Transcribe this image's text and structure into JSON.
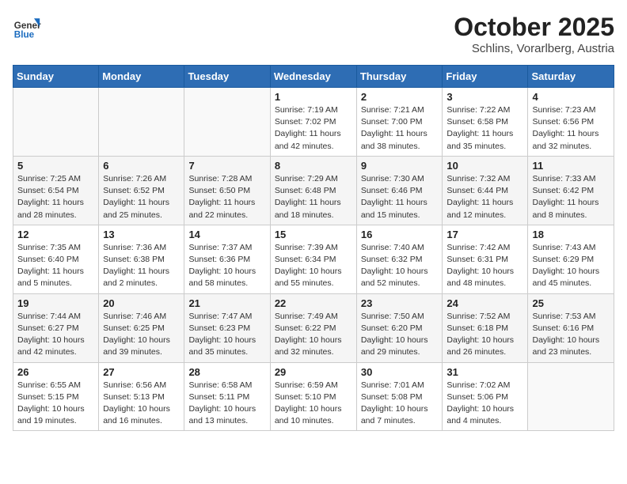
{
  "header": {
    "logo_general": "General",
    "logo_blue": "Blue",
    "month": "October 2025",
    "location": "Schlins, Vorarlberg, Austria"
  },
  "weekdays": [
    "Sunday",
    "Monday",
    "Tuesday",
    "Wednesday",
    "Thursday",
    "Friday",
    "Saturday"
  ],
  "weeks": [
    [
      {
        "day": "",
        "info": ""
      },
      {
        "day": "",
        "info": ""
      },
      {
        "day": "",
        "info": ""
      },
      {
        "day": "1",
        "info": "Sunrise: 7:19 AM\nSunset: 7:02 PM\nDaylight: 11 hours and 42 minutes."
      },
      {
        "day": "2",
        "info": "Sunrise: 7:21 AM\nSunset: 7:00 PM\nDaylight: 11 hours and 38 minutes."
      },
      {
        "day": "3",
        "info": "Sunrise: 7:22 AM\nSunset: 6:58 PM\nDaylight: 11 hours and 35 minutes."
      },
      {
        "day": "4",
        "info": "Sunrise: 7:23 AM\nSunset: 6:56 PM\nDaylight: 11 hours and 32 minutes."
      }
    ],
    [
      {
        "day": "5",
        "info": "Sunrise: 7:25 AM\nSunset: 6:54 PM\nDaylight: 11 hours and 28 minutes."
      },
      {
        "day": "6",
        "info": "Sunrise: 7:26 AM\nSunset: 6:52 PM\nDaylight: 11 hours and 25 minutes."
      },
      {
        "day": "7",
        "info": "Sunrise: 7:28 AM\nSunset: 6:50 PM\nDaylight: 11 hours and 22 minutes."
      },
      {
        "day": "8",
        "info": "Sunrise: 7:29 AM\nSunset: 6:48 PM\nDaylight: 11 hours and 18 minutes."
      },
      {
        "day": "9",
        "info": "Sunrise: 7:30 AM\nSunset: 6:46 PM\nDaylight: 11 hours and 15 minutes."
      },
      {
        "day": "10",
        "info": "Sunrise: 7:32 AM\nSunset: 6:44 PM\nDaylight: 11 hours and 12 minutes."
      },
      {
        "day": "11",
        "info": "Sunrise: 7:33 AM\nSunset: 6:42 PM\nDaylight: 11 hours and 8 minutes."
      }
    ],
    [
      {
        "day": "12",
        "info": "Sunrise: 7:35 AM\nSunset: 6:40 PM\nDaylight: 11 hours and 5 minutes."
      },
      {
        "day": "13",
        "info": "Sunrise: 7:36 AM\nSunset: 6:38 PM\nDaylight: 11 hours and 2 minutes."
      },
      {
        "day": "14",
        "info": "Sunrise: 7:37 AM\nSunset: 6:36 PM\nDaylight: 10 hours and 58 minutes."
      },
      {
        "day": "15",
        "info": "Sunrise: 7:39 AM\nSunset: 6:34 PM\nDaylight: 10 hours and 55 minutes."
      },
      {
        "day": "16",
        "info": "Sunrise: 7:40 AM\nSunset: 6:32 PM\nDaylight: 10 hours and 52 minutes."
      },
      {
        "day": "17",
        "info": "Sunrise: 7:42 AM\nSunset: 6:31 PM\nDaylight: 10 hours and 48 minutes."
      },
      {
        "day": "18",
        "info": "Sunrise: 7:43 AM\nSunset: 6:29 PM\nDaylight: 10 hours and 45 minutes."
      }
    ],
    [
      {
        "day": "19",
        "info": "Sunrise: 7:44 AM\nSunset: 6:27 PM\nDaylight: 10 hours and 42 minutes."
      },
      {
        "day": "20",
        "info": "Sunrise: 7:46 AM\nSunset: 6:25 PM\nDaylight: 10 hours and 39 minutes."
      },
      {
        "day": "21",
        "info": "Sunrise: 7:47 AM\nSunset: 6:23 PM\nDaylight: 10 hours and 35 minutes."
      },
      {
        "day": "22",
        "info": "Sunrise: 7:49 AM\nSunset: 6:22 PM\nDaylight: 10 hours and 32 minutes."
      },
      {
        "day": "23",
        "info": "Sunrise: 7:50 AM\nSunset: 6:20 PM\nDaylight: 10 hours and 29 minutes."
      },
      {
        "day": "24",
        "info": "Sunrise: 7:52 AM\nSunset: 6:18 PM\nDaylight: 10 hours and 26 minutes."
      },
      {
        "day": "25",
        "info": "Sunrise: 7:53 AM\nSunset: 6:16 PM\nDaylight: 10 hours and 23 minutes."
      }
    ],
    [
      {
        "day": "26",
        "info": "Sunrise: 6:55 AM\nSunset: 5:15 PM\nDaylight: 10 hours and 19 minutes."
      },
      {
        "day": "27",
        "info": "Sunrise: 6:56 AM\nSunset: 5:13 PM\nDaylight: 10 hours and 16 minutes."
      },
      {
        "day": "28",
        "info": "Sunrise: 6:58 AM\nSunset: 5:11 PM\nDaylight: 10 hours and 13 minutes."
      },
      {
        "day": "29",
        "info": "Sunrise: 6:59 AM\nSunset: 5:10 PM\nDaylight: 10 hours and 10 minutes."
      },
      {
        "day": "30",
        "info": "Sunrise: 7:01 AM\nSunset: 5:08 PM\nDaylight: 10 hours and 7 minutes."
      },
      {
        "day": "31",
        "info": "Sunrise: 7:02 AM\nSunset: 5:06 PM\nDaylight: 10 hours and 4 minutes."
      },
      {
        "day": "",
        "info": ""
      }
    ]
  ]
}
